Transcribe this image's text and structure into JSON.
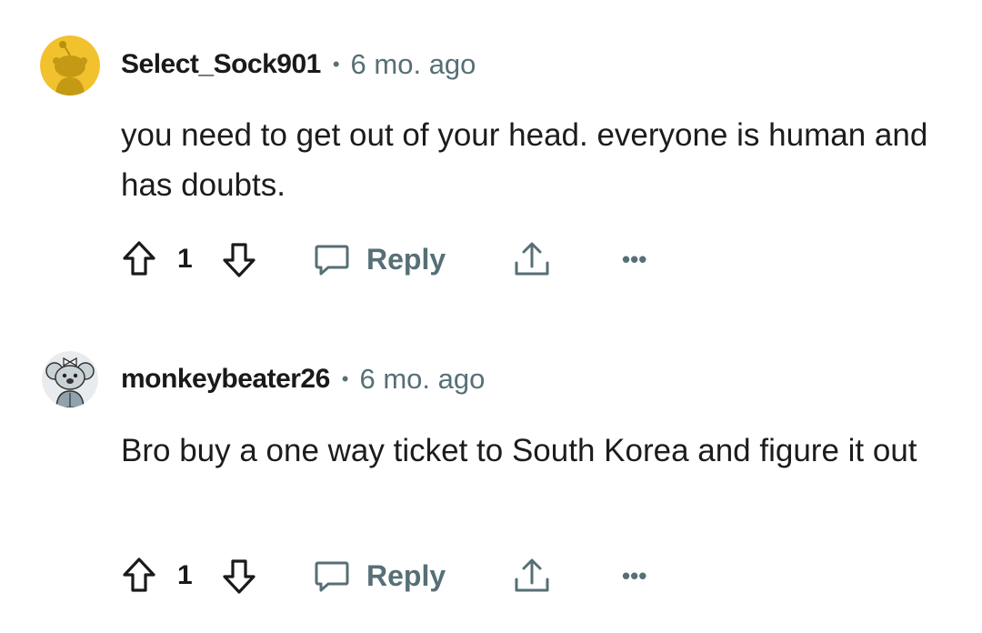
{
  "comments": [
    {
      "username": "Select_Sock901",
      "separator": "•",
      "time": "6 mo. ago",
      "text": "you need to get out of your head. everyone is human and has doubts.",
      "score": "1",
      "reply_label": "Reply",
      "more_label": "•••",
      "avatar_color": "#f2c12e"
    },
    {
      "username": "monkeybeater26",
      "separator": "•",
      "time": "6 mo. ago",
      "text": "Bro buy a one way ticket to South Korea and figure it out",
      "score": "1",
      "reply_label": "Reply",
      "more_label": "•••",
      "avatar_color": "#e9ecee"
    }
  ],
  "colors": {
    "text": "#1c1c1c",
    "meta": "#576f76",
    "background": "#ffffff"
  }
}
